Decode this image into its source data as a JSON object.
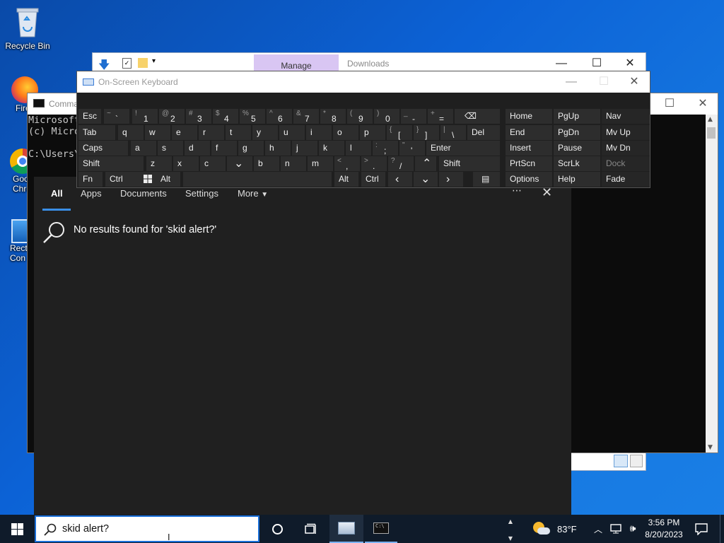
{
  "desktop": {
    "icons": [
      {
        "label": "Recycle Bin"
      },
      {
        "label": "Fire"
      },
      {
        "label": "Goo\nChro"
      },
      {
        "label": "Rect\nCon"
      }
    ]
  },
  "explorer": {
    "manage_tab": "Manage",
    "downloads_tab": "Downloads"
  },
  "cmd": {
    "title": "Comma",
    "lines": [
      "Microsoft",
      "(c) Micro",
      "",
      "C:\\Users\\"
    ]
  },
  "osk": {
    "title": "On-Screen Keyboard",
    "rows": [
      [
        {
          "label": "Esc"
        },
        {
          "shift": "~",
          "main": "`"
        },
        {
          "shift": "!",
          "main": "1"
        },
        {
          "shift": "@",
          "main": "2"
        },
        {
          "shift": "#",
          "main": "3"
        },
        {
          "shift": "$",
          "main": "4"
        },
        {
          "shift": "%",
          "main": "5"
        },
        {
          "shift": "^",
          "main": "6"
        },
        {
          "shift": "&",
          "main": "7"
        },
        {
          "shift": "*",
          "main": "8"
        },
        {
          "shift": "(",
          "main": "9"
        },
        {
          "shift": ")",
          "main": "0"
        },
        {
          "shift": "_",
          "main": "-"
        },
        {
          "shift": "+",
          "main": "="
        },
        {
          "label": "⌫"
        }
      ],
      [
        {
          "label": "Tab"
        },
        {
          "label": "q"
        },
        {
          "label": "w"
        },
        {
          "label": "e"
        },
        {
          "label": "r"
        },
        {
          "label": "t"
        },
        {
          "label": "y"
        },
        {
          "label": "u"
        },
        {
          "label": "i"
        },
        {
          "label": "o"
        },
        {
          "label": "p"
        },
        {
          "shift": "{",
          "main": "["
        },
        {
          "shift": "}",
          "main": "]"
        },
        {
          "shift": "|",
          "main": "\\"
        },
        {
          "label": "Del"
        }
      ],
      [
        {
          "label": "Caps"
        },
        {
          "label": "a"
        },
        {
          "label": "s"
        },
        {
          "label": "d"
        },
        {
          "label": "f"
        },
        {
          "label": "g"
        },
        {
          "label": "h"
        },
        {
          "label": "j"
        },
        {
          "label": "k"
        },
        {
          "label": "l"
        },
        {
          "shift": ":",
          "main": ";"
        },
        {
          "shift": "\"",
          "main": "'"
        },
        {
          "label": "Enter"
        }
      ],
      [
        {
          "label": "Shift"
        },
        {
          "label": "z"
        },
        {
          "label": "x"
        },
        {
          "label": "c"
        },
        {
          "label": "v"
        },
        {
          "label": "b"
        },
        {
          "label": "n"
        },
        {
          "label": "m"
        },
        {
          "shift": "<",
          "main": ","
        },
        {
          "shift": ">",
          "main": "."
        },
        {
          "shift": "?",
          "main": "/"
        },
        {
          "label": "^"
        },
        {
          "label": "Shift"
        }
      ],
      [
        {
          "label": "Fn"
        },
        {
          "label": "Ctrl"
        },
        {
          "label": "win"
        },
        {
          "label": "Alt"
        },
        {
          "label": ""
        },
        {
          "label": "Alt"
        },
        {
          "label": "Ctrl"
        },
        {
          "label": "<"
        },
        {
          "label": "v"
        },
        {
          "label": ">"
        },
        {
          "label": "menu"
        }
      ]
    ],
    "nav_keys": [
      [
        "Home",
        "PgUp",
        "Nav"
      ],
      [
        "End",
        "PgDn",
        "Mv Up"
      ],
      [
        "Insert",
        "Pause",
        "Mv Dn"
      ],
      [
        "PrtScn",
        "ScrLk",
        "Dock"
      ],
      [
        "Options",
        "Help",
        "Fade"
      ]
    ]
  },
  "search_panel": {
    "tabs": [
      "All",
      "Apps",
      "Documents",
      "Settings",
      "More"
    ],
    "more_menu": "⋯",
    "no_results": "No results found for 'skid alert?'"
  },
  "taskbar": {
    "search_value": "skid alert?",
    "temperature": "83°F",
    "time": "3:56 PM",
    "date": "8/20/2023"
  }
}
